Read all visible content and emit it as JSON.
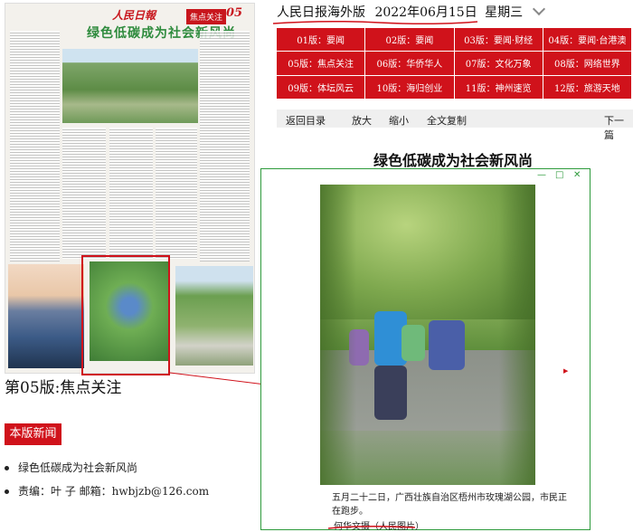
{
  "paper_thumb": {
    "brand": "人民日報",
    "section": "焦点关注",
    "page_num": "05",
    "headline": "绿色低碳成为社会新风尚"
  },
  "page_title": "第05版:焦点关注",
  "news_button": "本版新闻",
  "bullets": [
    "绿色低碳成为社会新风尚",
    "责编：叶 子 邮箱：hwbjzb@126.com"
  ],
  "header": {
    "title": "人民日报海外版",
    "date": "2022年06月15日",
    "weekday": "星期三"
  },
  "editions": [
    "01版：要闻",
    "02版：要闻",
    "03版：要闻·财经",
    "04版：要闻·台港澳",
    "05版：焦点关注",
    "06版：华侨华人",
    "07版：文化万象",
    "08版：网络世界",
    "09版：体坛风云",
    "10版：海归创业",
    "11版：神州速览",
    "12版：旅游天地"
  ],
  "toolbar": {
    "back": "返回目录",
    "zoom_in": "放大",
    "zoom_out": "缩小",
    "copy": "全文复制",
    "next": "下一篇"
  },
  "article_title": "绿色低碳成为社会新风尚",
  "popup": {
    "min": "—",
    "max": "□",
    "close": "✕",
    "caption": "五月二十二日，广西壮族自治区梧州市玫瑰湖公园，市民正在跑步。",
    "credit": "何华文摄（人民图片）"
  },
  "colors": {
    "accent_red": "#d0121b",
    "popup_border": "#2d9a3b"
  }
}
